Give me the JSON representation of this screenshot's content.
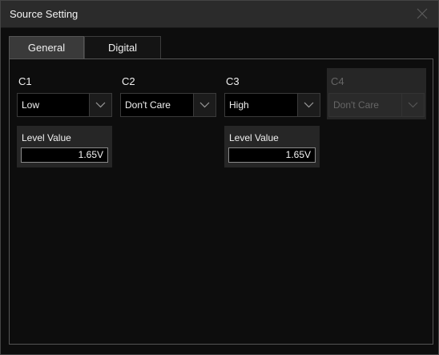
{
  "window": {
    "title": "Source Setting"
  },
  "tabs": [
    {
      "label": "General",
      "active": true
    },
    {
      "label": "Digital",
      "active": false
    }
  ],
  "channels": [
    {
      "name": "C1",
      "value": "Low",
      "enabled": true
    },
    {
      "name": "C2",
      "value": "Don't Care",
      "enabled": true
    },
    {
      "name": "C3",
      "value": "High",
      "enabled": true
    },
    {
      "name": "C4",
      "value": "Don't Care",
      "enabled": false
    }
  ],
  "level_c1": {
    "label": "Level Value",
    "value": "1.65V"
  },
  "level_c3": {
    "label": "Level Value",
    "value": "1.65V"
  },
  "icons": {
    "close": "close-icon",
    "dropdown": "chevron-down-icon"
  },
  "colors": {
    "background": "#0d0d0d",
    "titlebar": "#2b2b2b",
    "disabled_text": "#666666"
  }
}
